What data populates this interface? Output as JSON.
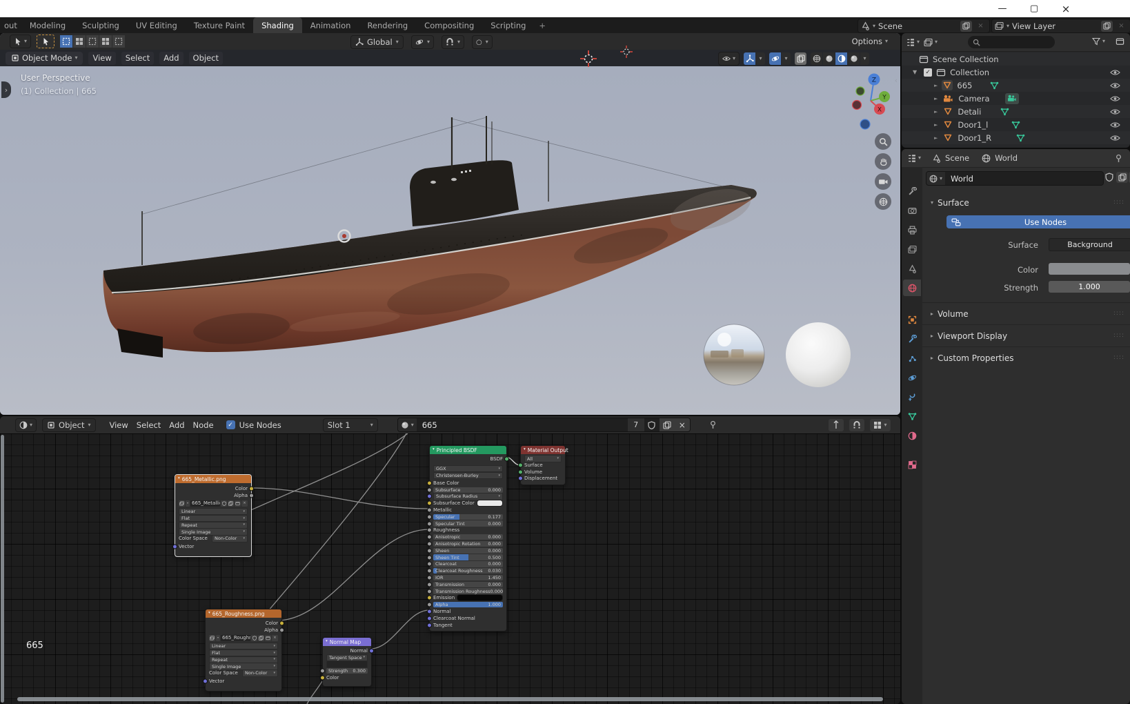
{
  "icons": {
    "caret": "▾",
    "tri_down": "▼",
    "tri_right": "►",
    "check": "✓",
    "close": "×",
    "circle": "○",
    "plus": "+",
    "chev_right": "›",
    "chev_left": "‹",
    "arrow_up": "↑",
    "grip": "::::"
  },
  "colors": {
    "accent": "#4772b3",
    "node_header_green": "#249960",
    "node_header_orange": "#bf6c2e",
    "node_header_purple": "#7a6ed2",
    "node_header_red": "#7e3330",
    "sky_top": "#a6adbd",
    "sky_bottom": "#b9bdc7"
  },
  "topbar": {
    "tabs": [
      "out",
      "Modeling",
      "Sculpting",
      "UV Editing",
      "Texture Paint",
      "Shading",
      "Animation",
      "Rendering",
      "Compositing",
      "Scripting"
    ],
    "active_tab": "Shading",
    "add_tab": "+",
    "scene": "Scene",
    "view_layer": "View Layer"
  },
  "tools": {
    "orientation": "Global",
    "options": "Options"
  },
  "viewport": {
    "mode": "Object Mode",
    "menu_view": "View",
    "menu_select": "Select",
    "menu_add": "Add",
    "menu_object": "Object",
    "overlay1": "User Perspective",
    "overlay2": "(1) Collection | 665",
    "ax_x": "X",
    "ax_y": "Y",
    "ax_z": "Z"
  },
  "outliner": {
    "root": "Scene Collection",
    "collection": "Collection",
    "obj1": "665",
    "obj2": "Camera",
    "obj3": "Detali",
    "obj4": "Door1_l",
    "obj5": "Door1_R"
  },
  "props": {
    "bc_scene": "Scene",
    "bc_world": "World",
    "datablock": "World",
    "surface_title": "Surface",
    "use_nodes": "Use Nodes",
    "lbl_surface": "Surface",
    "val_surface": "Background",
    "lbl_color": "Color",
    "lbl_strength": "Strength",
    "val_strength": "1.000",
    "panel_volume": "Volume",
    "panel_viewport": "Viewport Display",
    "panel_custom": "Custom Properties"
  },
  "shader": {
    "scope": "Object",
    "menu_view": "View",
    "menu_select": "Select",
    "menu_add": "Add",
    "menu_node": "Node",
    "use_nodes": "Use Nodes",
    "slot": "Slot 1",
    "material": "665",
    "users": "7",
    "tree_path": "665",
    "tex1": {
      "title": "665_Metallic.png",
      "out1": "Color",
      "out2": "Alpha",
      "image": "665_Metallic.png",
      "dd1": "Linear",
      "dd2": "Flat",
      "dd3": "Repeat",
      "dd4": "Single Image",
      "cs_label": "Color Space",
      "cs_value": "Non-Color",
      "in1": "Vector"
    },
    "tex2": {
      "title": "665_Roughness.png",
      "out1": "Color",
      "out2": "Alpha",
      "image": "665_Roughness...",
      "dd1": "Linear",
      "dd2": "Flat",
      "dd3": "Repeat",
      "dd4": "Single Image",
      "cs_label": "Color Space",
      "cs_value": "Non-Color",
      "in1": "Vector"
    },
    "nmap": {
      "title": "Normal Map",
      "out1": "Normal",
      "dd1": "Tangent Space",
      "lbl_strength": "Strength",
      "val_strength": "0.300",
      "in1": "Color"
    },
    "outnode": {
      "title": "Material Output",
      "dd1": "All",
      "in1": "Surface",
      "in2": "Volume",
      "in3": "Displacement"
    },
    "bsdf": {
      "title": "Principled BSDF",
      "out1": "BSDF",
      "dd1": "GGX",
      "dd2": "Christensen-Burley",
      "inputs": [
        {
          "label": "Base Color"
        },
        {
          "label": "Subsurface",
          "value": "0.000",
          "fill": 0
        },
        {
          "label": "Subsurface Radius"
        },
        {
          "label": "Subsurface Color"
        },
        {
          "label": "Metallic"
        },
        {
          "label": "Specular",
          "value": "0.177",
          "fill": 0.38
        },
        {
          "label": "Specular Tint",
          "value": "0.000",
          "fill": 0
        },
        {
          "label": "Roughness"
        },
        {
          "label": "Anisotropic",
          "value": "0.000",
          "fill": 0
        },
        {
          "label": "Anisotropic Rotation",
          "value": "0.000",
          "fill": 0
        },
        {
          "label": "Sheen",
          "value": "0.000",
          "fill": 0
        },
        {
          "label": "Sheen Tint",
          "value": "0.500",
          "fill": 0.5
        },
        {
          "label": "Clearcoat",
          "value": "0.000",
          "fill": 0
        },
        {
          "label": "Clearcoat Roughness",
          "value": "0.030",
          "fill": 0.05
        },
        {
          "label": "IOR",
          "value": "1.450",
          "fill": 0
        },
        {
          "label": "Transmission",
          "value": "0.000",
          "fill": 0
        },
        {
          "label": "Transmission Roughness",
          "value": "0.000",
          "fill": 0
        },
        {
          "label": "Emission"
        },
        {
          "label": "Alpha",
          "value": "1.000",
          "fill": 1
        },
        {
          "label": "Normal"
        },
        {
          "label": "Clearcoat Normal"
        },
        {
          "label": "Tangent"
        }
      ]
    }
  }
}
